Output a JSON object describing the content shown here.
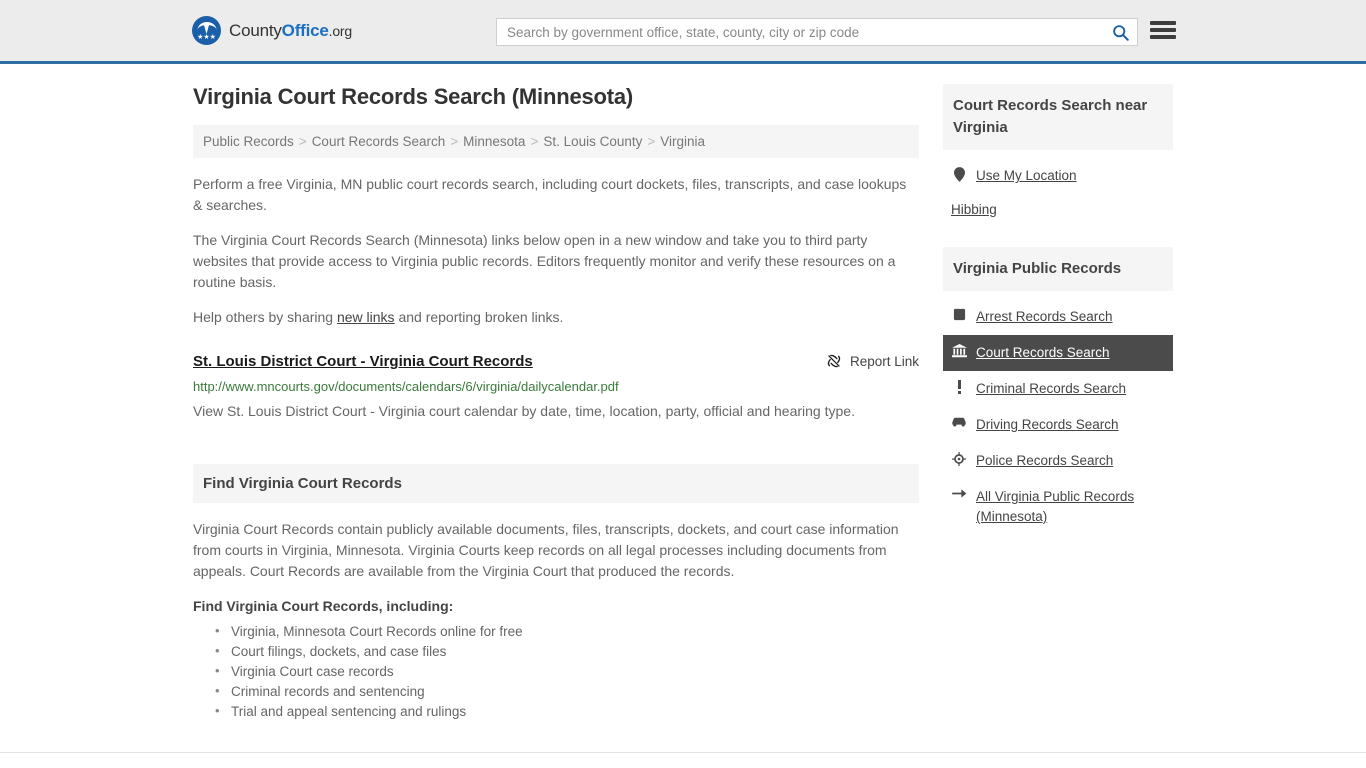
{
  "header": {
    "brand": {
      "part1": "County",
      "part2": "Office",
      "part3": ".org",
      "logo_icon": "eagle-seal-icon"
    },
    "search": {
      "placeholder": "Search by government office, state, county, city or zip code",
      "value": "",
      "search_icon": "search-icon"
    },
    "menu_icon": "hamburger-menu-icon"
  },
  "page": {
    "title": "Virginia Court Records Search (Minnesota)"
  },
  "breadcrumb": {
    "separator": ">",
    "items": [
      {
        "label": "Public Records"
      },
      {
        "label": "Court Records Search"
      },
      {
        "label": "Minnesota"
      },
      {
        "label": "St. Louis County"
      },
      {
        "label": "Virginia"
      }
    ]
  },
  "intro": {
    "p1": "Perform a free Virginia, MN public court records search, including court dockets, files, transcripts, and case lookups & searches.",
    "p2": "The Virginia Court Records Search (Minnesota) links below open in a new window and take you to third party websites that provide access to Virginia public records. Editors frequently monitor and verify these resources on a routine basis.",
    "p3_before": "Help others by sharing ",
    "p3_link": "new links",
    "p3_after": " and reporting broken links."
  },
  "result": {
    "title": "St. Louis District Court - Virginia Court Records",
    "url": "http://www.mncourts.gov/documents/calendars/6/virginia/dailycalendar.pdf",
    "description": "View St. Louis District Court - Virginia court calendar by date, time, location, party, official and hearing type.",
    "report_label": "Report Link",
    "report_icon": "broken-link-icon"
  },
  "section": {
    "heading": "Find Virginia Court Records",
    "paragraph": "Virginia Court Records contain publicly available documents, files, transcripts, dockets, and court case information from courts in Virginia, Minnesota. Virginia Courts keep records on all legal processes including documents from appeals. Court Records are available from the Virginia Court that produced the records.",
    "sub_heading": "Find Virginia Court Records, including:",
    "bullets": [
      "Virginia, Minnesota Court Records online for free",
      "Court filings, dockets, and case files",
      "Virginia Court case records",
      "Criminal records and sentencing",
      "Trial and appeal sentencing and rulings"
    ]
  },
  "sidebar": {
    "near_box": {
      "heading": "Court Records Search near Virginia",
      "use_location": {
        "label": "Use My Location",
        "icon": "map-pin-icon"
      },
      "places": [
        "Hibbing"
      ]
    },
    "records_box": {
      "heading": "Virginia Public Records",
      "items": [
        {
          "label": "Arrest Records Search",
          "icon": "■",
          "icon_name": "handcuffs-icon",
          "active": false
        },
        {
          "label": "Court Records Search",
          "icon": "🏛",
          "icon_name": "courthouse-icon",
          "active": true
        },
        {
          "label": "Criminal Records Search",
          "icon": "❗",
          "icon_name": "exclamation-icon",
          "active": false
        },
        {
          "label": "Driving Records Search",
          "icon": "🚗",
          "icon_name": "car-icon",
          "active": false
        },
        {
          "label": "Police Records Search",
          "icon": "⊕",
          "icon_name": "police-badge-icon",
          "active": false
        },
        {
          "label": "All Virginia Public Records (Minnesota)",
          "icon": "→",
          "icon_name": "arrow-right-icon",
          "active": false
        }
      ]
    }
  },
  "colors": {
    "header_bg": "#ececec",
    "header_border": "#2e6da4",
    "brand_blue": "#1a6fc4",
    "active_item_bg": "#4b4b4b",
    "panel_bg": "#f5f5f5",
    "url_green": "#3a7a3a"
  }
}
